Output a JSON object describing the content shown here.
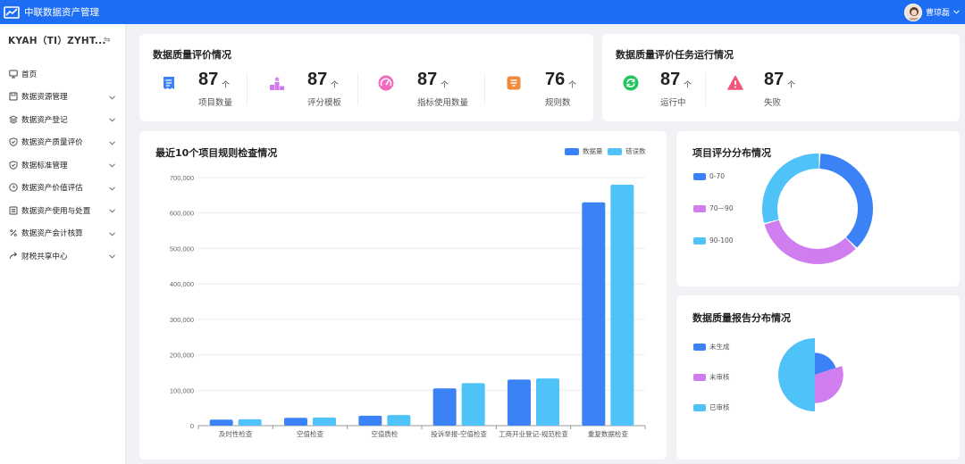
{
  "header": {
    "title": "中联数据资产管理",
    "user_name": "曹琼磊"
  },
  "sidebar": {
    "org": "KYAH（TI）ZYHT...",
    "items": [
      {
        "label": "首页",
        "icon": "monitor-icon",
        "has_children": false
      },
      {
        "label": "数据资源管理",
        "icon": "save-icon",
        "has_children": true
      },
      {
        "label": "数据资产登记",
        "icon": "layers-icon",
        "has_children": true
      },
      {
        "label": "数据资产质量评价",
        "icon": "shield-check-icon",
        "has_children": true
      },
      {
        "label": "数据标准管理",
        "icon": "shield-check-icon",
        "has_children": true
      },
      {
        "label": "数据资产价值评估",
        "icon": "clock-icon",
        "has_children": true
      },
      {
        "label": "数据资产使用与处置",
        "icon": "list-icon",
        "has_children": true
      },
      {
        "label": "数据资产会计核算",
        "icon": "percent-icon",
        "has_children": true
      },
      {
        "label": "财税共享中心",
        "icon": "share-icon",
        "has_children": true
      }
    ]
  },
  "quality": {
    "title": "数据质量评价情况",
    "stats": [
      {
        "value": "87",
        "unit": "个",
        "label": "项目数量",
        "icon": "list-doc-icon",
        "color": "#3b82f6"
      },
      {
        "value": "87",
        "unit": "个",
        "label": "评分模板",
        "icon": "podium-icon",
        "color": "#d379f0"
      },
      {
        "value": "87",
        "unit": "个",
        "label": "指标使用数量",
        "icon": "gauge-icon",
        "color": "#f06bc2"
      },
      {
        "value": "76",
        "unit": "个",
        "label": "规则数",
        "icon": "doc-icon",
        "color": "#f08a3c"
      }
    ]
  },
  "tasks": {
    "title": "数据质量评价任务运行情况",
    "stats": [
      {
        "value": "87",
        "unit": "个",
        "label": "运行中",
        "icon": "refresh-icon",
        "color": "#22c55e"
      },
      {
        "value": "87",
        "unit": "个",
        "label": "失败",
        "icon": "warning-icon",
        "color": "#f0557a"
      }
    ]
  },
  "colors": {
    "blue": "#3b82f6",
    "cyan": "#4fc3f7",
    "purple": "#d07df0"
  },
  "chart_data": [
    {
      "type": "bar",
      "title": "最近10个项目规则检查情况",
      "legend_position": "top-right",
      "categories": [
        "及时性检查",
        "空值检查",
        "空值质检",
        "投诉举报-空值检查",
        "工商开业登记-规范检查",
        "重复数据检查"
      ],
      "series": [
        {
          "name": "数据量",
          "values": [
            17000,
            22000,
            28000,
            105000,
            130000,
            630000
          ],
          "color": "#3b82f6"
        },
        {
          "name": "错误数",
          "values": [
            18000,
            23000,
            30000,
            120000,
            133000,
            680000
          ],
          "color": "#4fc3f7"
        }
      ],
      "ylim": [
        0,
        700000
      ],
      "yticks": [
        "0",
        "100,000",
        "200,000",
        "300,000",
        "400,000",
        "500,000",
        "600,000",
        "700,000"
      ],
      "grid": true
    },
    {
      "type": "pie",
      "title": "项目评分分布情况",
      "variant": "donut",
      "labels": [
        "0-70",
        "70—90",
        "90-100"
      ],
      "values": [
        37,
        33,
        30
      ],
      "colors": [
        "#3b82f6",
        "#d07df0",
        "#4fc3f7"
      ],
      "legend_position": "left"
    },
    {
      "type": "pie",
      "title": "数据质量报告分布情况",
      "variant": "rose",
      "labels": [
        "未生成",
        "未审核",
        "已审核"
      ],
      "values": [
        20,
        30,
        50
      ],
      "colors": [
        "#3b82f6",
        "#d07df0",
        "#4fc3f7"
      ],
      "legend_position": "left"
    }
  ]
}
